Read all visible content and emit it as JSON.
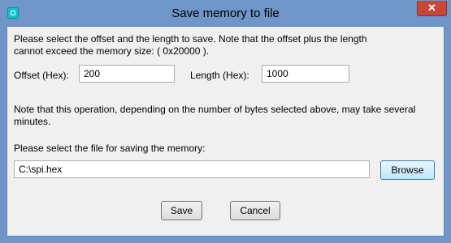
{
  "window": {
    "title": "Save memory to file",
    "close_glyph": "✕"
  },
  "instructions": {
    "line1": "Please select the offset and the length to save. Note that the offset plus the length",
    "line2": "cannot exceed the memory size: ( 0x20000 )."
  },
  "offset": {
    "label": "Offset (Hex):",
    "value": "200"
  },
  "length": {
    "label": "Length (Hex):",
    "value": "1000"
  },
  "note": {
    "line1": "Note that this operation, depending on the number of bytes selected above, may take several",
    "line2": "minutes."
  },
  "file": {
    "label": "Please select the file for saving the memory:",
    "value": "C:\\spi.hex",
    "browse_label": "Browse"
  },
  "actions": {
    "save_label": "Save",
    "cancel_label": "Cancel"
  }
}
